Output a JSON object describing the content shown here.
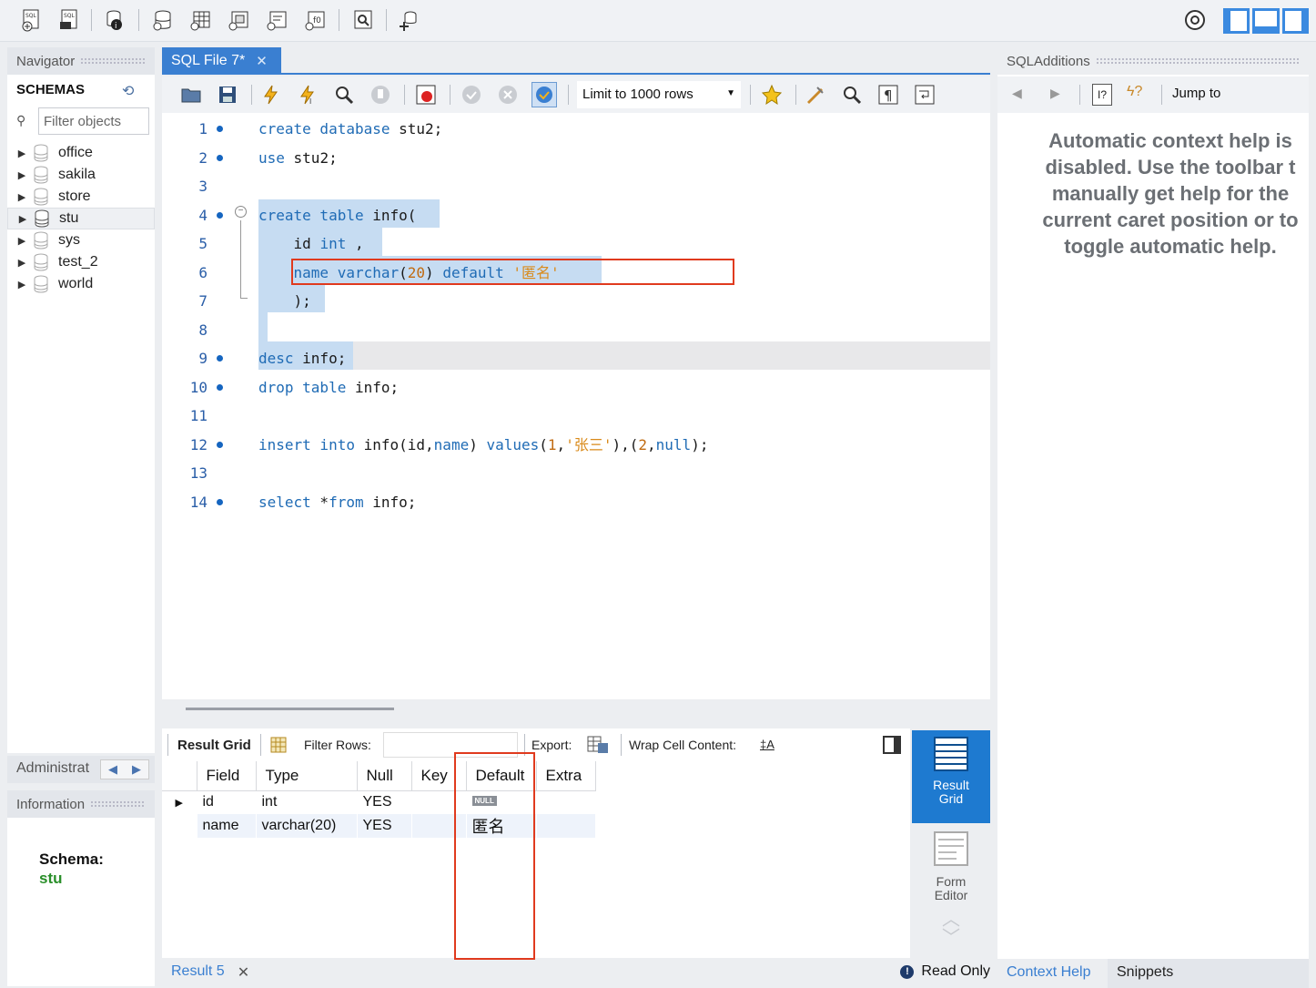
{
  "toolbar": {
    "icons": [
      "new-sql-tab-icon",
      "open-sql-script-icon",
      "inspector-icon",
      "create-schema-icon",
      "create-table-icon",
      "create-view-icon",
      "create-procedure-icon",
      "create-function-icon",
      "search-table-data-icon",
      "reconnect-icon",
      "settings-icon",
      "layout-toggle-icons"
    ]
  },
  "navigator": {
    "header": "Navigator",
    "schemas_title": "SCHEMAS",
    "filter_placeholder": "Filter objects",
    "schemas": [
      "office",
      "sakila",
      "store",
      "stu",
      "sys",
      "test_2",
      "world"
    ],
    "selected_schema": "stu"
  },
  "admin_tab": "Administrat",
  "information": {
    "header": "Information",
    "schema_label": "Schema:",
    "schema_value": "stu"
  },
  "editor": {
    "tab_title": "SQL File 7*",
    "limit_select": "Limit to 1000 rows",
    "lines": [
      {
        "n": "1"
      },
      {
        "n": "2"
      },
      {
        "n": "3"
      },
      {
        "n": "4"
      },
      {
        "n": "5"
      },
      {
        "n": "6"
      },
      {
        "n": "7"
      },
      {
        "n": "8"
      },
      {
        "n": "9"
      },
      {
        "n": "10"
      },
      {
        "n": "11"
      },
      {
        "n": "12"
      },
      {
        "n": "13"
      },
      {
        "n": "14"
      }
    ],
    "code": {
      "l1": [
        "create database",
        " stu2;"
      ],
      "l2": [
        "use",
        " stu2;"
      ],
      "l4": [
        "create table",
        " info("
      ],
      "l5": [
        "    id ",
        "int",
        " ,"
      ],
      "l6": [
        "    ",
        "name",
        " ",
        "varchar",
        "(",
        "20",
        ") ",
        "default",
        " ",
        "'匿名'"
      ],
      "l7": [
        "    );"
      ],
      "l9": [
        "desc",
        " info;"
      ],
      "l10": [
        "drop table",
        " info;"
      ],
      "l12": [
        "insert into",
        " info(id,",
        "name",
        ") ",
        "values",
        "(",
        "1",
        ",",
        "'张三'",
        "),(",
        "2",
        ",",
        "null",
        ");"
      ],
      "l14": [
        "select",
        " *",
        "from",
        " info;"
      ]
    }
  },
  "results": {
    "result_grid_label": "Result Grid",
    "filter_rows_label": "Filter Rows:",
    "export_label": "Export:",
    "wrap_label": "Wrap Cell Content:",
    "columns": [
      "Field",
      "Type",
      "Null",
      "Key",
      "Default",
      "Extra"
    ],
    "rows": [
      {
        "field": "id",
        "type": "int",
        "null": "YES",
        "key": "",
        "default": "NULL",
        "extra": ""
      },
      {
        "field": "name",
        "type": "varchar(20)",
        "null": "YES",
        "key": "",
        "default": "匿名",
        "extra": ""
      }
    ],
    "tab_label": "Result 5",
    "read_only": "Read Only",
    "view_result_grid": "Result Grid",
    "view_form_editor": "Form Editor"
  },
  "sql_additions": {
    "header": "SQLAdditions",
    "jump_to": "Jump to",
    "help_text": "Automatic context help is\ndisabled. Use the toolbar t\nmanually get help for the\ncurrent caret position or to\ntoggle automatic help.",
    "tab_context_help": "Context Help",
    "tab_snippets": "Snippets"
  },
  "colors": {
    "accent": "#3a7fd1",
    "keyword": "#1f6bb5",
    "string": "#d98a1a",
    "highlight_box": "#e03a1e",
    "schema_value": "#2a8f2a"
  }
}
